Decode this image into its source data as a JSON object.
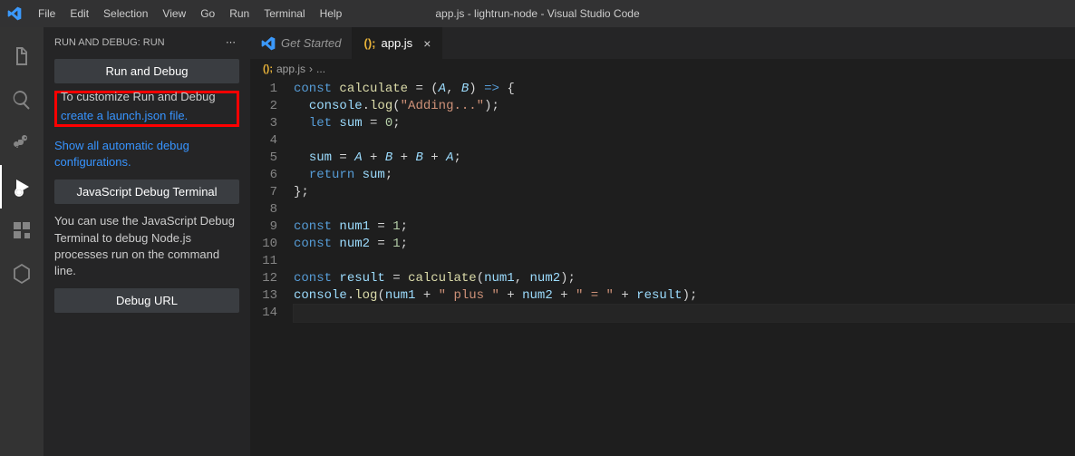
{
  "window_title": "app.js - lightrun-node - Visual Studio Code",
  "menu": [
    "File",
    "Edit",
    "Selection",
    "View",
    "Go",
    "Run",
    "Terminal",
    "Help"
  ],
  "sidebar": {
    "header": "RUN AND DEBUG: RUN",
    "run_debug_btn": "Run and Debug",
    "cutoff_text": "To customize Run and Debug",
    "create_launch": "create a launch.json file.",
    "show_all_link": "Show all automatic debug configurations.",
    "js_terminal_btn": "JavaScript Debug Terminal",
    "js_terminal_desc": "You can use the JavaScript Debug Terminal to debug Node.js processes run on the command line.",
    "debug_url_btn": "Debug URL"
  },
  "tabs": {
    "get_started": "Get Started",
    "appjs": "app.js"
  },
  "breadcrumb": {
    "icon_label": "();",
    "file": "app.js",
    "sep": "›",
    "rest": "..."
  },
  "code_lines": [
    {
      "n": 1,
      "tokens": [
        [
          "kw",
          "const "
        ],
        [
          "fn-name",
          "calculate"
        ],
        [
          "op",
          " = "
        ],
        [
          "pun",
          "("
        ],
        [
          "param",
          "A"
        ],
        [
          "pun",
          ", "
        ],
        [
          "param",
          "B"
        ],
        [
          "pun",
          ") "
        ],
        [
          "arrow",
          "=>"
        ],
        [
          "pun",
          " {"
        ]
      ]
    },
    {
      "n": 2,
      "tokens": [
        [
          "",
          "  "
        ],
        [
          "var",
          "console"
        ],
        [
          "pun",
          "."
        ],
        [
          "fn-name",
          "log"
        ],
        [
          "pun",
          "("
        ],
        [
          "str",
          "\"Adding...\""
        ],
        [
          "pun",
          ");"
        ]
      ]
    },
    {
      "n": 3,
      "tokens": [
        [
          "",
          "  "
        ],
        [
          "kw",
          "let "
        ],
        [
          "var",
          "sum"
        ],
        [
          "op",
          " = "
        ],
        [
          "num",
          "0"
        ],
        [
          "pun",
          ";"
        ]
      ]
    },
    {
      "n": 4,
      "tokens": []
    },
    {
      "n": 5,
      "tokens": [
        [
          "",
          "  "
        ],
        [
          "var",
          "sum"
        ],
        [
          "op",
          " = "
        ],
        [
          "param",
          "A"
        ],
        [
          "op",
          " + "
        ],
        [
          "param",
          "B"
        ],
        [
          "op",
          " + "
        ],
        [
          "param",
          "B"
        ],
        [
          "op",
          " + "
        ],
        [
          "param",
          "A"
        ],
        [
          "pun",
          ";"
        ]
      ]
    },
    {
      "n": 6,
      "tokens": [
        [
          "",
          "  "
        ],
        [
          "kw",
          "return "
        ],
        [
          "var",
          "sum"
        ],
        [
          "pun",
          ";"
        ]
      ]
    },
    {
      "n": 7,
      "tokens": [
        [
          "pun",
          "};"
        ]
      ]
    },
    {
      "n": 8,
      "tokens": []
    },
    {
      "n": 9,
      "tokens": [
        [
          "kw",
          "const "
        ],
        [
          "var",
          "num1"
        ],
        [
          "op",
          " = "
        ],
        [
          "num",
          "1"
        ],
        [
          "pun",
          ";"
        ]
      ]
    },
    {
      "n": 10,
      "tokens": [
        [
          "kw",
          "const "
        ],
        [
          "var",
          "num2"
        ],
        [
          "op",
          " = "
        ],
        [
          "num",
          "1"
        ],
        [
          "pun",
          ";"
        ]
      ]
    },
    {
      "n": 11,
      "tokens": []
    },
    {
      "n": 12,
      "tokens": [
        [
          "kw",
          "const "
        ],
        [
          "var",
          "result"
        ],
        [
          "op",
          " = "
        ],
        [
          "fn-name",
          "calculate"
        ],
        [
          "pun",
          "("
        ],
        [
          "var",
          "num1"
        ],
        [
          "pun",
          ", "
        ],
        [
          "var",
          "num2"
        ],
        [
          "pun",
          ");"
        ]
      ]
    },
    {
      "n": 13,
      "tokens": [
        [
          "var",
          "console"
        ],
        [
          "pun",
          "."
        ],
        [
          "fn-name",
          "log"
        ],
        [
          "pun",
          "("
        ],
        [
          "var",
          "num1"
        ],
        [
          "op",
          " + "
        ],
        [
          "str",
          "\" plus \""
        ],
        [
          "op",
          " + "
        ],
        [
          "var",
          "num2"
        ],
        [
          "op",
          " + "
        ],
        [
          "str",
          "\" = \""
        ],
        [
          "op",
          " + "
        ],
        [
          "var",
          "result"
        ],
        [
          "pun",
          ");"
        ]
      ]
    },
    {
      "n": 14,
      "tokens": []
    }
  ]
}
